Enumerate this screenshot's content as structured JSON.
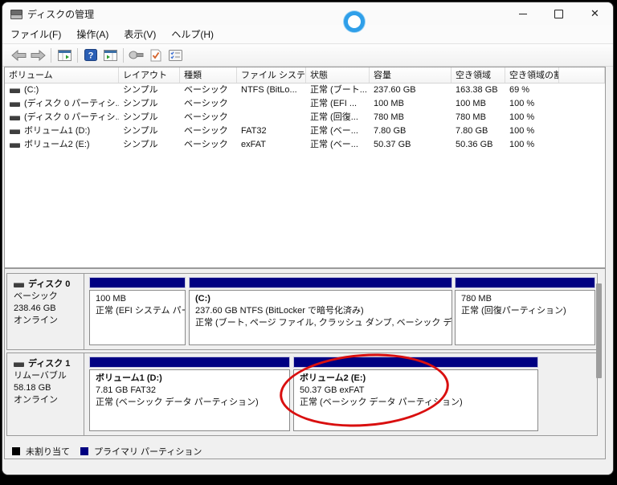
{
  "window": {
    "title": "ディスクの管理",
    "controls": {
      "minimize": "minimize",
      "maximize": "maximize",
      "close": "✕"
    }
  },
  "menu": {
    "items": [
      {
        "label": "ファイル(F)"
      },
      {
        "label": "操作(A)"
      },
      {
        "label": "表示(V)"
      },
      {
        "label": "ヘルプ(H)"
      }
    ]
  },
  "toolbar": {
    "icons": [
      "back-arrow-icon",
      "forward-arrow-icon",
      "console-tree-icon",
      "help-icon",
      "action-pane-icon",
      "disk-tool-icon",
      "check-document-icon",
      "property-list-icon"
    ]
  },
  "volume_table": {
    "columns": [
      "ボリューム",
      "レイアウト",
      "種類",
      "ファイル システム",
      "状態",
      "容量",
      "空き領域",
      "空き領域の割..."
    ],
    "rows": [
      {
        "volume": "(C:)",
        "layout": "シンプル",
        "type": "ベーシック",
        "fs": "NTFS (BitLo...",
        "status": "正常 (ブート...",
        "capacity": "237.60 GB",
        "free": "163.38 GB",
        "percent": "69 %"
      },
      {
        "volume": "(ディスク 0 パーティシ...",
        "layout": "シンプル",
        "type": "ベーシック",
        "fs": "",
        "status": "正常 (EFI ...",
        "capacity": "100 MB",
        "free": "100 MB",
        "percent": "100 %"
      },
      {
        "volume": "(ディスク 0 パーティシ...",
        "layout": "シンプル",
        "type": "ベーシック",
        "fs": "",
        "status": "正常 (回復...",
        "capacity": "780 MB",
        "free": "780 MB",
        "percent": "100 %"
      },
      {
        "volume": "ボリューム1 (D:)",
        "layout": "シンプル",
        "type": "ベーシック",
        "fs": "FAT32",
        "status": "正常 (ベー...",
        "capacity": "7.80 GB",
        "free": "7.80 GB",
        "percent": "100 %"
      },
      {
        "volume": "ボリューム2 (E:)",
        "layout": "シンプル",
        "type": "ベーシック",
        "fs": "exFAT",
        "status": "正常 (ベー...",
        "capacity": "50.37 GB",
        "free": "50.36 GB",
        "percent": "100 %"
      }
    ]
  },
  "disks": [
    {
      "name": "ディスク 0",
      "kind": "ベーシック",
      "size": "238.46 GB",
      "status": "オンライン",
      "partitions": [
        {
          "title": "",
          "line1": "100 MB",
          "line2": "正常 (EFI システム パー"
        },
        {
          "title": "(C:)",
          "line1": "237.60 GB NTFS (BitLocker で暗号化済み)",
          "line2": "正常 (ブート, ページ ファイル, クラッシュ ダンプ, ベーシック データ パーテ"
        },
        {
          "title": "",
          "line1": "780 MB",
          "line2": "正常 (回復パーティション)"
        }
      ]
    },
    {
      "name": "ディスク 1",
      "kind": "リムーバブル",
      "size": "58.18 GB",
      "status": "オンライン",
      "partitions": [
        {
          "title": "ボリューム1  (D:)",
          "line1": "7.81 GB FAT32",
          "line2": "正常 (ベーシック データ パーティション)"
        },
        {
          "title": "ボリューム2  (E:)",
          "line1": "50.37 GB exFAT",
          "line2": "正常 (ベーシック データ パーティション)"
        }
      ]
    }
  ],
  "legend": {
    "items": [
      {
        "label": "未割り当て",
        "color": "#000000"
      },
      {
        "label": "プライマリ パーティション",
        "color": "#000080"
      }
    ]
  },
  "colors": {
    "partition_navy": "#000082",
    "annotation_red": "#D90F0F",
    "touch_ring_blue": "#2F9FE9"
  }
}
